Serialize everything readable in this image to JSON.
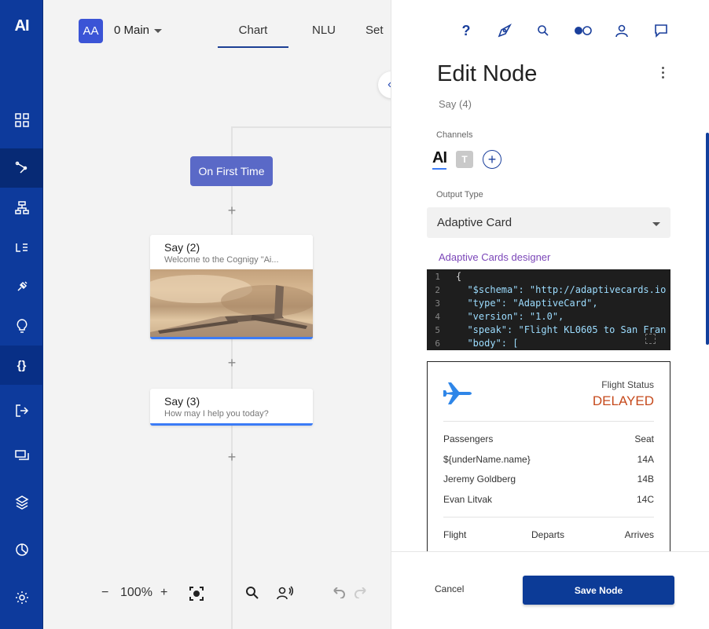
{
  "app": {
    "logo": "AI"
  },
  "sidebar": {
    "items": [
      {
        "icon": "grid-icon"
      },
      {
        "icon": "flow-icon"
      },
      {
        "icon": "hierarchy-icon"
      },
      {
        "icon": "lexicon-icon"
      },
      {
        "icon": "plug-icon"
      },
      {
        "icon": "lightbulb-icon"
      },
      {
        "icon": "braces-icon",
        "label": "{}"
      },
      {
        "icon": "logout-icon"
      },
      {
        "icon": "chat-icon"
      },
      {
        "icon": "layers-icon"
      },
      {
        "icon": "analytics-icon"
      },
      {
        "icon": "gear-icon"
      }
    ]
  },
  "header": {
    "avatar_initials": "AA",
    "flow_name": "0 Main",
    "tabs": [
      {
        "label": "Chart"
      },
      {
        "label": "NLU"
      },
      {
        "label": "Set"
      }
    ]
  },
  "canvas": {
    "start_node": "On First Time",
    "nodes": [
      {
        "title": "Say (2)",
        "subtitle": "Welcome to the Cognigy \"Ai..."
      },
      {
        "title": "Say (3)",
        "subtitle": "How may I help you today?"
      }
    ],
    "zoom": "100%",
    "zoom_out": "−",
    "zoom_in": "+"
  },
  "panel": {
    "title": "Edit Node",
    "subtitle": "Say (4)",
    "channels_label": "Channels",
    "channel_ai": "AI",
    "channel_teams": "T",
    "output_type_label": "Output Type",
    "output_type_value": "Adaptive Card",
    "designer_link": "Adaptive Cards designer",
    "code": {
      "line_numbers": [
        "1",
        "2",
        "3",
        "4",
        "5",
        "6"
      ],
      "lines": [
        "{",
        "  \"$schema\": \"http://adaptivecards.io",
        "  \"type\": \"AdaptiveCard\",",
        "  \"version\": \"1.0\",",
        "  \"speak\": \"Flight KL0605 to San Fran",
        "  \"body\": ["
      ]
    },
    "card": {
      "status_label": "Flight Status",
      "status_value": "DELAYED",
      "status_color": "#c64a1c",
      "passengers_header": "Passengers",
      "seat_header": "Seat",
      "passengers": [
        {
          "name": "${underName.name}",
          "seat": "14A"
        },
        {
          "name": "Jeremy Goldberg",
          "seat": "14B"
        },
        {
          "name": "Evan Litvak",
          "seat": "14C"
        }
      ],
      "flight_header": "Flight",
      "departs_header": "Departs",
      "arrives_header": "Arrives"
    },
    "cancel_label": "Cancel",
    "save_label": "Save Node"
  },
  "colors": {
    "sidebar": "#0d3a9c",
    "accent": "#1a3f9c",
    "start_node": "#5a69c7",
    "link": "#7b46b8"
  }
}
